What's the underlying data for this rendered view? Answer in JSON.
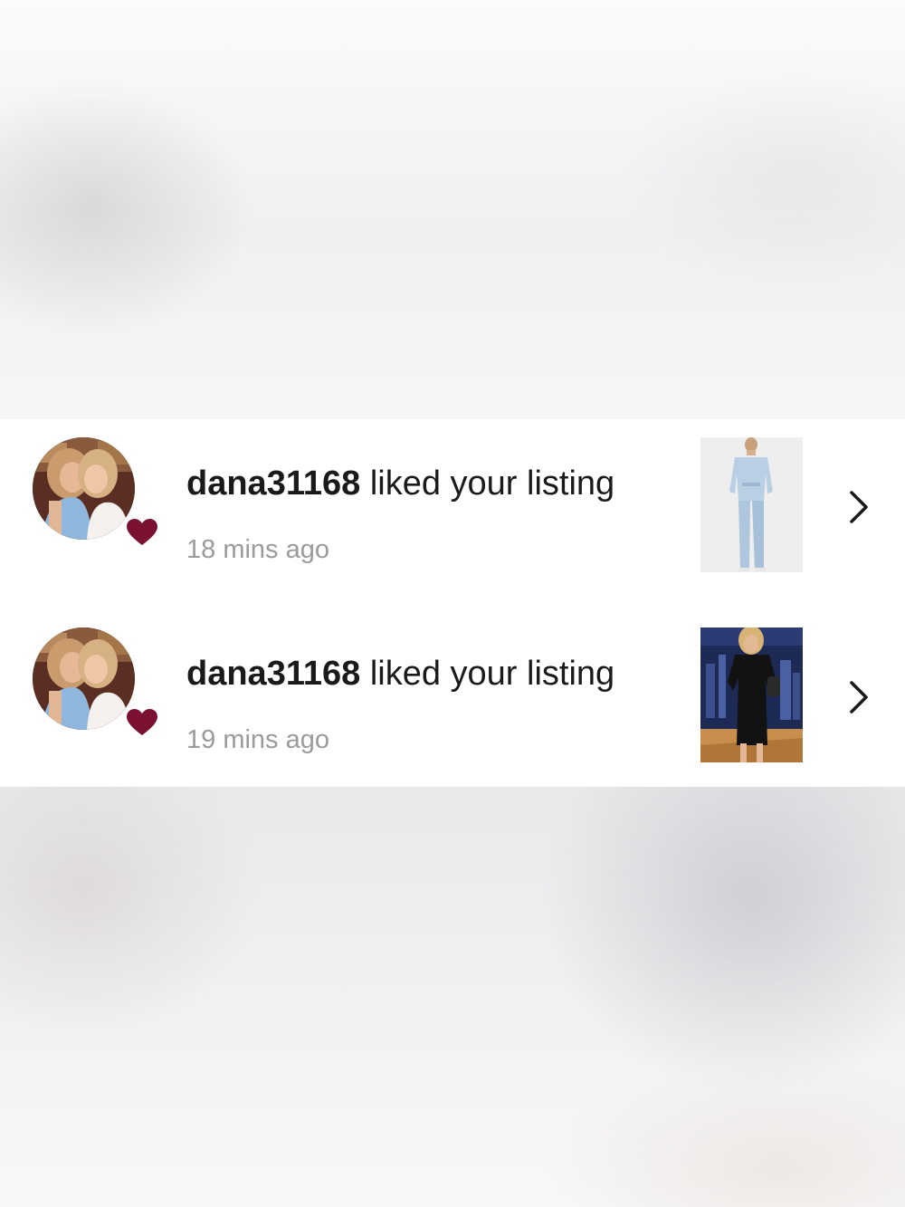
{
  "notifications": [
    {
      "username": "dana31168",
      "action": "liked your listing",
      "time": "18 mins ago",
      "listing": "denim-jumpsuit"
    },
    {
      "username": "dana31168",
      "action": "liked your listing",
      "time": "19 mins ago",
      "listing": "black-mini-dress"
    }
  ],
  "colors": {
    "heart": "#7a1131",
    "timestamp": "#9b9b9b",
    "text": "#1a1a1a"
  }
}
